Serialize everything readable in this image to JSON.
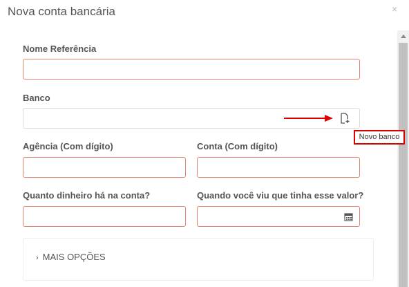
{
  "modal": {
    "title": "Nova conta bancária",
    "close_symbol": "×"
  },
  "form": {
    "nome_label": "Nome Referência",
    "nome_value": "",
    "banco_label": "Banco",
    "banco_value": "",
    "agencia_label": "Agência (Com dígito)",
    "agencia_value": "",
    "conta_label": "Conta (Com dígito)",
    "conta_value": "",
    "quanto_label": "Quanto dinheiro há na conta?",
    "quanto_value": "",
    "quando_label": "Quando você viu que tinha esse valor?",
    "quando_value": ""
  },
  "tooltip": {
    "novo_banco": "Novo banco"
  },
  "more_options": {
    "label": "MAIS OPÇÕES",
    "chevron": "›"
  },
  "icons": {
    "add_bank": "add-document-icon",
    "calendar": "calendar-icon",
    "annotation": "red-arrow"
  },
  "colors": {
    "required_border": "#e8856f",
    "annotation": "#dd0000"
  }
}
